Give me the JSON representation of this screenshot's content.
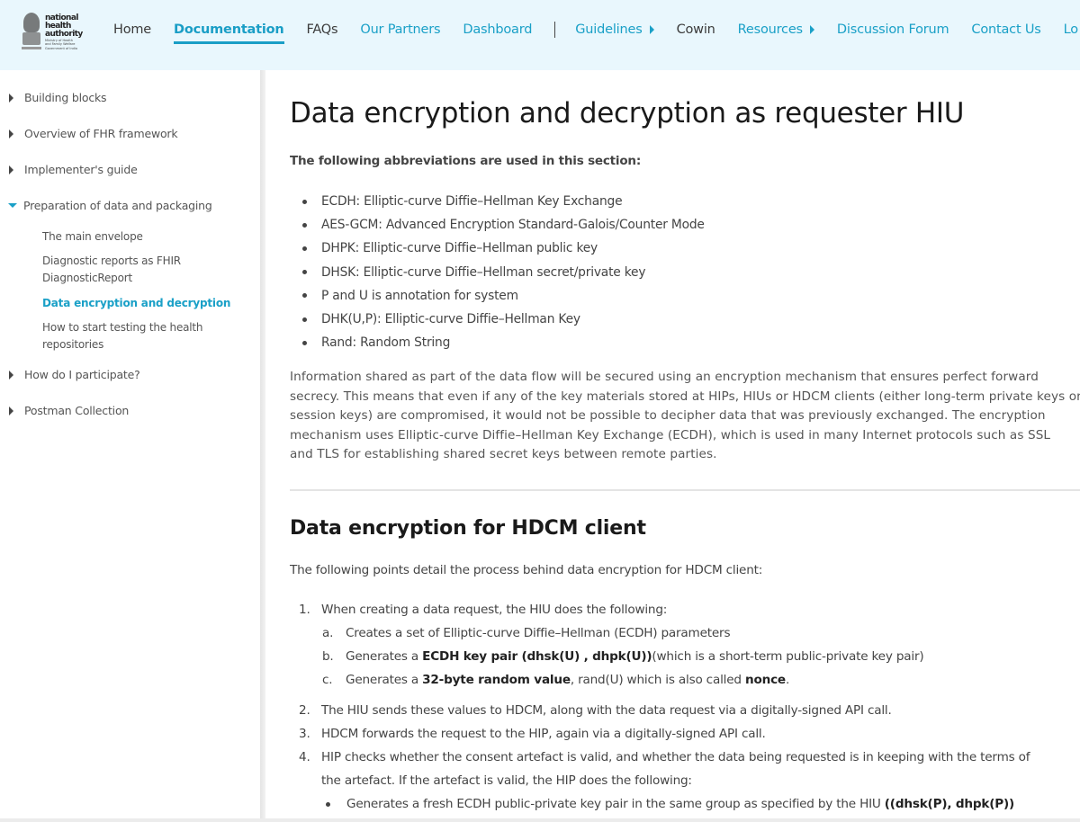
{
  "header": {
    "logo": {
      "line1": "national",
      "line2": "health",
      "line3": "authority",
      "sub1": "Ministry of Health",
      "sub2": "and Family Welfare",
      "sub3": "Government of India"
    },
    "nav": [
      {
        "label": "Home"
      },
      {
        "label": "Documentation",
        "active": true
      },
      {
        "label": "FAQs"
      },
      {
        "label": "Our Partners"
      },
      {
        "label": "Dashboard"
      },
      {
        "label": "Guidelines",
        "has_submenu": true
      },
      {
        "label": "Cowin"
      },
      {
        "label": "Resources",
        "has_submenu": true
      },
      {
        "label": "Discussion Forum"
      },
      {
        "label": "Contact Us"
      },
      {
        "label": "Lo"
      }
    ],
    "accent_color": "#1aa0c7"
  },
  "sidebar": {
    "items": [
      {
        "label": "Building blocks",
        "expanded": false
      },
      {
        "label": "Overview of FHR framework",
        "expanded": false
      },
      {
        "label": "Implementer's guide",
        "expanded": false
      },
      {
        "label": "Preparation of data and packaging",
        "expanded": true,
        "children": [
          {
            "label": "The main envelope"
          },
          {
            "label": "Diagnostic reports as FHIR DiagnosticReport"
          },
          {
            "label": "Data encryption and decryption",
            "active": true
          },
          {
            "label": "How to start testing the health repositories"
          }
        ]
      },
      {
        "label": "How do I participate?",
        "expanded": false
      },
      {
        "label": "Postman Collection",
        "expanded": false
      }
    ]
  },
  "main": {
    "title": "Data encryption and decryption as requester HIU",
    "abbr_intro": "The following abbreviations are used in this section:",
    "abbreviations": [
      "ECDH: Elliptic-curve Diffie–Hellman Key Exchange",
      "AES-GCM: Advanced Encryption Standard-Galois/Counter Mode",
      "DHPK: Elliptic-curve Diffie–Hellman public key",
      "DHSK: Elliptic-curve Diffie–Hellman secret/private key",
      "P and U is annotation for system",
      "DHK(U,P): Elliptic-curve Diffie–Hellman Key",
      "Rand: Random String"
    ],
    "paragraph_lines": [
      "Information shared as part of the data flow will be secured using an encryption mechanism that ensures perfect forward",
      "secrecy. This means that even if any of the key materials stored at HIPs, HIUs or HDCM clients (either long-term private keys or",
      "session keys) are compromised, it would not be possible to decipher data that was previously exchanged. The encryption",
      "mechanism uses Elliptic-curve Diffie–Hellman Key Exchange (ECDH), which is used in many Internet protocols such as SSL",
      "and TLS for establishing shared secret keys between remote parties."
    ],
    "section_title": "Data encryption for HDCM client",
    "section_intro": "The following points detail the process behind data encryption for HDCM client:",
    "steps": {
      "s1": {
        "num": "1.",
        "text": "When creating a data request, the HIU does the following:"
      },
      "s1a": {
        "num": "a.",
        "text": "Creates a set of Elliptic-curve Diffie–Hellman (ECDH) parameters"
      },
      "s1b": {
        "num": "b.",
        "pre": "Generates a ",
        "bold": "ECDH key pair (dhsk(U) , dhpk(U))",
        "post": " (which is a short-term public-private key pair)"
      },
      "s1c": {
        "num": "c.",
        "pre": "Generates a ",
        "bold": "32-byte random value",
        "mid": ", rand(U) which is also called ",
        "bold2": "nonce",
        "post": "."
      },
      "s2": {
        "num": "2.",
        "text": "The HIU sends these values to HDCM, along with the data request via a digitally-signed API call."
      },
      "s3": {
        "num": "3.",
        "text": "HDCM forwards the request to the HIP, again via a digitally-signed API call."
      },
      "s4": {
        "num": "4.",
        "text": "HIP checks whether the consent artefact is valid, and whether the data being requested is in keeping with the terms of",
        "text2": "the artefact. If the artefact is valid, the HIP does the following:"
      },
      "s4b": {
        "pre": "Generates a fresh ECDH public-private key pair in the same group as specified by the HIU ",
        "bold": "((dhsk(P), dhpk(P))"
      }
    }
  }
}
